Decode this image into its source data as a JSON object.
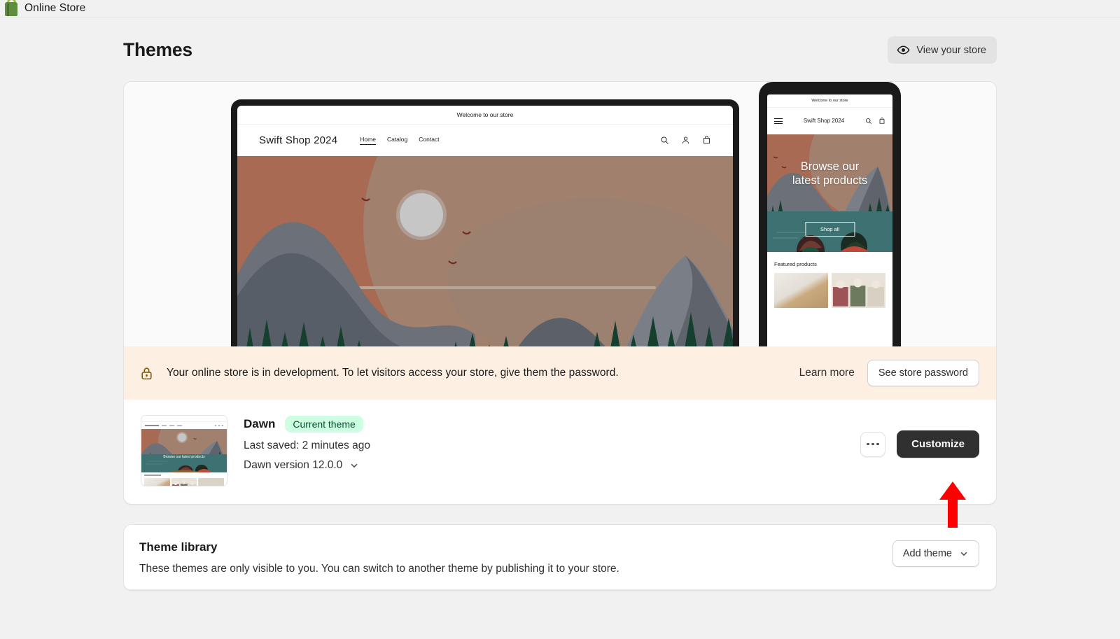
{
  "topbar": {
    "title": "Online Store",
    "logo_icon": "shopping-bag-icon"
  },
  "header": {
    "page_title": "Themes",
    "view_store_label": "View your store",
    "view_store_icon": "eye-icon"
  },
  "preview": {
    "desktop": {
      "announcement": "Welcome to our store",
      "logo": "Swift Shop 2024",
      "nav": [
        "Home",
        "Catalog",
        "Contact"
      ],
      "active_nav": "Home",
      "icons": [
        "search-icon",
        "account-icon",
        "cart-icon"
      ]
    },
    "mobile": {
      "announcement": "Welcome to our store",
      "menu_icon": "hamburger-menu-icon",
      "logo": "Swift Shop 2024",
      "icons": [
        "search-icon",
        "cart-icon"
      ],
      "hero_heading_line1": "Browse our",
      "hero_heading_line2": "latest products",
      "hero_button": "Shop all",
      "featured_title": "Featured products"
    }
  },
  "banner": {
    "icon": "lock-icon",
    "message": "Your online store is in development. To let visitors access your store, give them the password.",
    "learn_more_label": "Learn more",
    "see_password_label": "See store password",
    "background_color": "#FDF0E3"
  },
  "theme": {
    "name": "Dawn",
    "badge": "Current theme",
    "badge_bg": "#CDFEE1",
    "badge_text_color": "#0C5132",
    "last_saved": "Last saved: 2 minutes ago",
    "version": "Dawn version 12.0.0",
    "version_chevron_icon": "chevron-down-icon",
    "more_actions_icon": "ellipsis-icon",
    "customize_label": "Customize",
    "thumbnail_hero_text": "Browse our latest products"
  },
  "annotation": {
    "type": "arrow-up",
    "color": "#FF0000",
    "points_to": "Customize"
  },
  "library": {
    "title": "Theme library",
    "description": "These themes are only visible to you. You can switch to another theme by publishing it to your store.",
    "add_theme_label": "Add theme",
    "add_theme_chevron_icon": "chevron-down-icon"
  }
}
